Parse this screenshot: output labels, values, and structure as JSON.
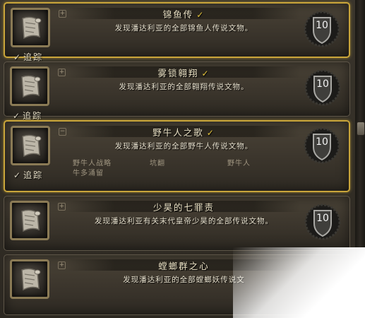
{
  "achievements": [
    {
      "title": "锦鱼传",
      "completed_mark": "✓",
      "description": "发现潘达利亚的全部锦鱼人传说文物。",
      "tracked": true,
      "track_label": "追踪",
      "points": "10",
      "expanded": false,
      "criteria": []
    },
    {
      "title": "雾锁翱翔",
      "completed_mark": "✓",
      "description": "发现潘达利亚的全部翱翔传说文物。",
      "tracked": true,
      "track_label": "追踪",
      "points": "10",
      "expanded": false,
      "criteria": []
    },
    {
      "title": "野牛人之歌",
      "completed_mark": "✓",
      "description": "发现潘达利亚的全部野牛人传说文物。",
      "tracked": true,
      "track_label": "追踪",
      "points": "10",
      "expanded": true,
      "criteria": [
        "野牛人战略",
        "坑翻",
        "野牛人",
        "牛多涌留"
      ]
    },
    {
      "title": "少昊的七罪责",
      "completed_mark": "",
      "description": "发现潘达利亚有关末代皇帝少昊的全部传说文物。",
      "tracked": false,
      "track_label": "",
      "points": "10",
      "expanded": false,
      "criteria": []
    },
    {
      "title": "螳螂群之心",
      "completed_mark": "",
      "description": "发现潘达利亚的全部螳螂妖传说文",
      "tracked": false,
      "track_label": "",
      "points": "",
      "expanded": false,
      "criteria": []
    }
  ],
  "expand_symbols": {
    "collapsed": "+",
    "expanded": "−"
  },
  "track_check": "✓",
  "icons": {
    "achievement": "scroll-icon",
    "points": "shield-points-icon",
    "complete": "checkmark-icon"
  },
  "colors": {
    "selected_border": "#c9a53a",
    "title": "#ece3c6",
    "check": "#e2c23a",
    "description": "#e7e0cd",
    "criteria": "#9f9580"
  }
}
